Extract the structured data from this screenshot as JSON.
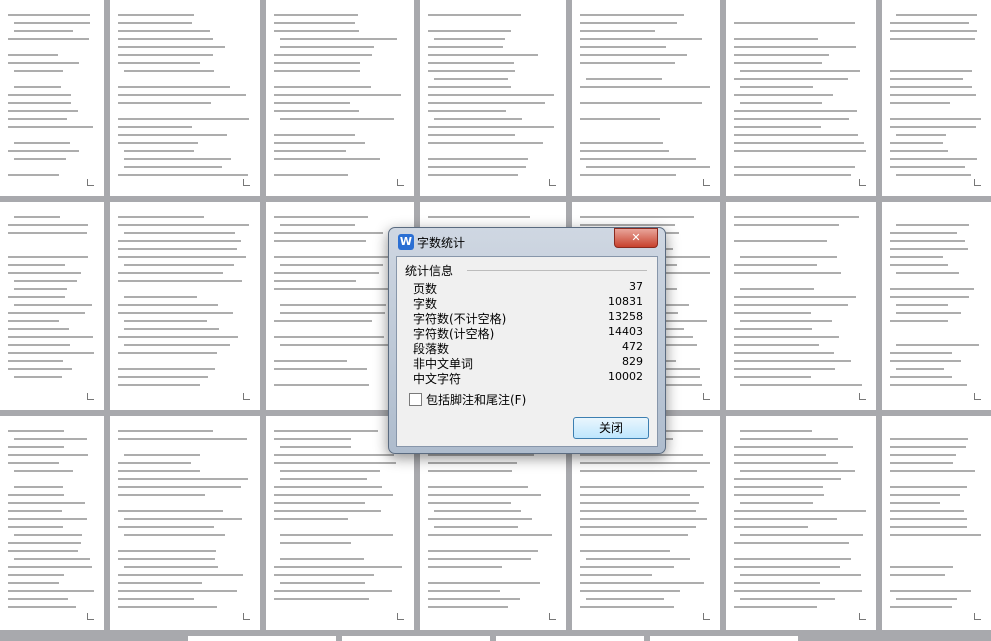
{
  "dialog": {
    "title": "字数统计",
    "icon": "wps-writer-icon",
    "close_glyph": "✕",
    "group_label": "统计信息",
    "stats": [
      {
        "label": "页数",
        "value": "37"
      },
      {
        "label": "字数",
        "value": "10831"
      },
      {
        "label": "字符数(不计空格)",
        "value": "13258"
      },
      {
        "label": "字符数(计空格)",
        "value": "14403"
      },
      {
        "label": "段落数",
        "value": "472"
      },
      {
        "label": "非中文单词",
        "value": "829"
      },
      {
        "label": "中文字符",
        "value": "10002"
      }
    ],
    "include_footnotes_label": "包括脚注和尾注(F)",
    "include_footnotes_checked": false,
    "close_button_label": "关闭"
  },
  "colors": {
    "workspace": "#a8a9ad",
    "page": "#ffffff",
    "close_x": "#c7412d",
    "button_border": "#3c7fb1"
  }
}
